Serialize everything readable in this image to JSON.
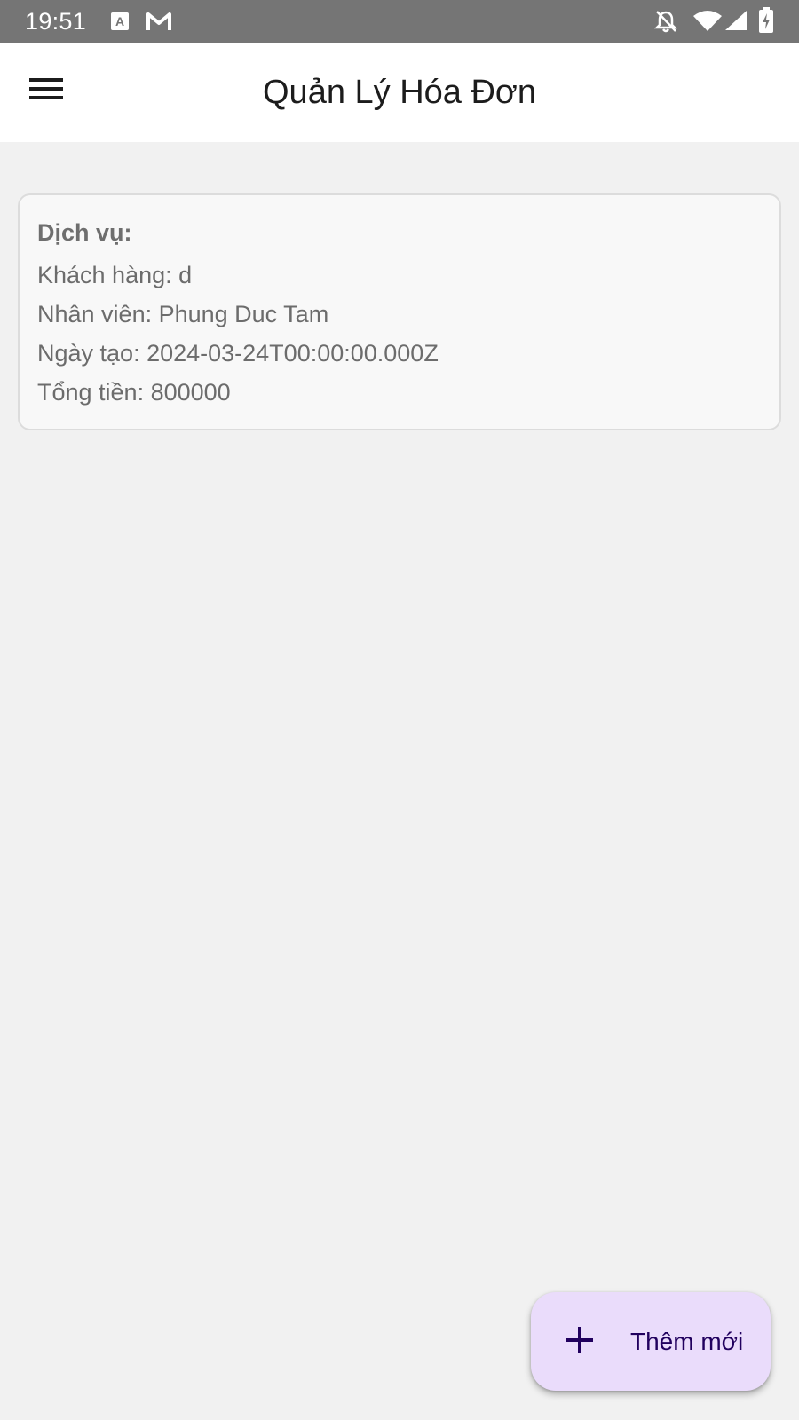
{
  "status_bar": {
    "time": "19:51",
    "left_icons": [
      "text-a-notification-icon",
      "gmail-icon"
    ],
    "right_icons": [
      "notifications-off-icon",
      "wifi-icon",
      "cell-signal-icon",
      "battery-charging-icon"
    ]
  },
  "app_bar": {
    "title": "Quản Lý Hóa Đơn",
    "menu_icon": "hamburger-menu-icon"
  },
  "invoices": [
    {
      "service": "Dịch vụ:",
      "customer": "Khách hàng: d",
      "employee": "Nhân viên: Phung Duc Tam",
      "created": "Ngày tạo: 2024-03-24T00:00:00.000Z",
      "total": "Tổng tiền: 800000"
    }
  ],
  "fab": {
    "label": "Thêm mới",
    "icon": "plus-icon"
  },
  "colors": {
    "status_bar": "#757575",
    "background": "#f1f1f1",
    "card_background": "#f8f8f8",
    "fab_background": "#eadcfb",
    "fab_text": "#21005e"
  }
}
